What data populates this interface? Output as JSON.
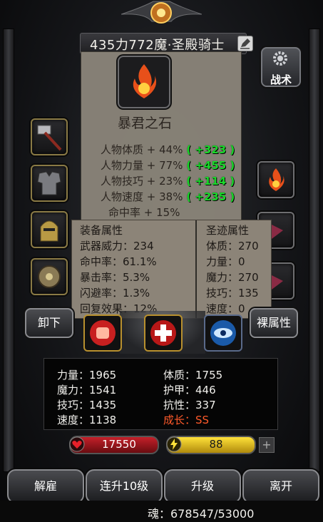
{
  "title": "435力772魔·圣殿骑士",
  "tactics_label": "战术",
  "item": {
    "name": "暴君之石",
    "stats": [
      {
        "label": "人物体质 + 44%",
        "bonus": "( +323 )"
      },
      {
        "label": "人物力量 + 77%",
        "bonus": "( +455 )"
      },
      {
        "label": "人物技巧 + 23%",
        "bonus": "( +114 )"
      },
      {
        "label": "人物速度 + 38%",
        "bonus": "( +235 )"
      },
      {
        "label": "命中率 + 15%",
        "bonus": ""
      }
    ]
  },
  "equip_props": {
    "header": "装备属性",
    "rows": [
      "武器威力：234",
      "命中率：61.1%",
      "暴击率：5.3%",
      "闪避率：1.3%",
      "回复效果：12%"
    ]
  },
  "relic_props": {
    "header": "圣迹属性",
    "rows": [
      "体质：270",
      "力量：0",
      "魔力：270",
      "技巧：135",
      "速度：0"
    ]
  },
  "buttons": {
    "unequip": "卸下",
    "naked_attr": "裸属性",
    "dismiss": "解雇",
    "upgrade10": "连升10级",
    "upgrade": "升级",
    "leave": "离开"
  },
  "stats": {
    "strength": "力量：1965",
    "magic": "魔力：1541",
    "skill": "技巧：1435",
    "speed": "速度：1138",
    "constitution": "体质：1755",
    "armor": "护甲：446",
    "resistance": "抗性：337",
    "growth_label": "成长：",
    "growth_value": "SS"
  },
  "hp": "17550",
  "energy": "88",
  "plus": "+",
  "soul": "魂：678547/53000",
  "colors": {
    "bonus": "#19d82a",
    "growth": "#ff5a2a",
    "hp": "#c4202a",
    "energy": "#ffe23a"
  }
}
